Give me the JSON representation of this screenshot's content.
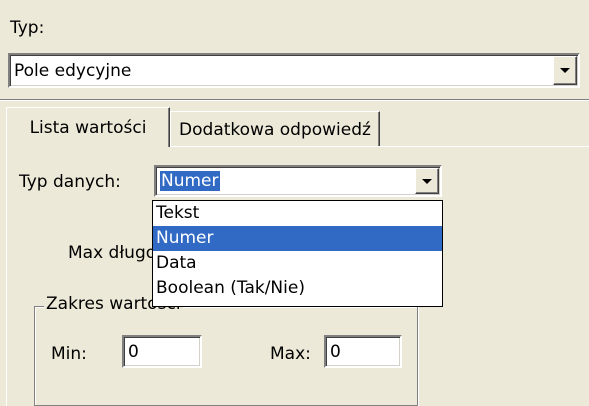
{
  "typ": {
    "label": "Typ:",
    "selected": "Pole edycyjne"
  },
  "tabs": [
    {
      "label": "Lista wartości",
      "active": true
    },
    {
      "label": "Dodatkowa odpowiedź",
      "active": false
    }
  ],
  "panel": {
    "typ_danych_label": "Typ danych:",
    "typ_danych_value": "Numer",
    "max_dlug_label": "Max długość",
    "zakres_label": "Zakres wartości",
    "min_label": "Min:",
    "min_value": "0",
    "max_label": "Max:",
    "max_value": "0"
  },
  "dropdown": {
    "options": [
      "Tekst",
      "Numer",
      "Data",
      "Boolean (Tak/Nie)"
    ],
    "selected_index": 1
  },
  "colors": {
    "window_bg": "#ece9d8",
    "selection": "#316ac5"
  }
}
